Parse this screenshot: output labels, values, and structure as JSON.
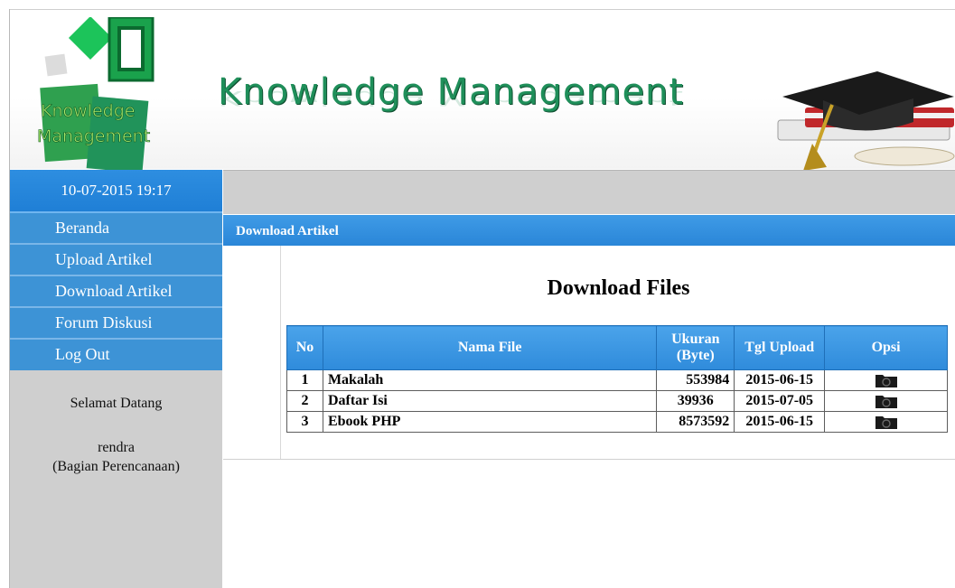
{
  "header": {
    "logo_line1": "Knowledge",
    "logo_line2": "Management",
    "title": "Knowledge Management"
  },
  "sidebar": {
    "datetime": "10-07-2015 19:17",
    "menu": [
      {
        "label": "Beranda"
      },
      {
        "label": "Upload Artikel"
      },
      {
        "label": "Download Artikel"
      },
      {
        "label": "Forum Diskusi"
      },
      {
        "label": "Log Out"
      }
    ],
    "welcome": "Selamat Datang",
    "user_name": "rendra",
    "user_dept": "(Bagian Perencanaan)"
  },
  "main": {
    "section_title": "Download Artikel",
    "heading": "Download Files",
    "table": {
      "headers": {
        "no": "No",
        "name": "Nama File",
        "size_line1": "Ukuran",
        "size_line2": "(Byte)",
        "date": "Tgl Upload",
        "option": "Opsi"
      },
      "rows": [
        {
          "no": "1",
          "name": "Makalah",
          "size": "553984",
          "date": "2015-06-15"
        },
        {
          "no": "2",
          "name": "Daftar Isi",
          "size": "39936",
          "date": "2015-07-05"
        },
        {
          "no": "3",
          "name": "Ebook PHP",
          "size": "8573592",
          "date": "2015-06-15"
        }
      ],
      "option_icon": "download-folder-icon"
    }
  },
  "colors": {
    "accent_blue": "#2a86d8",
    "title_green": "#1f8f5a",
    "sidebar_gray": "#cfcfcf"
  }
}
